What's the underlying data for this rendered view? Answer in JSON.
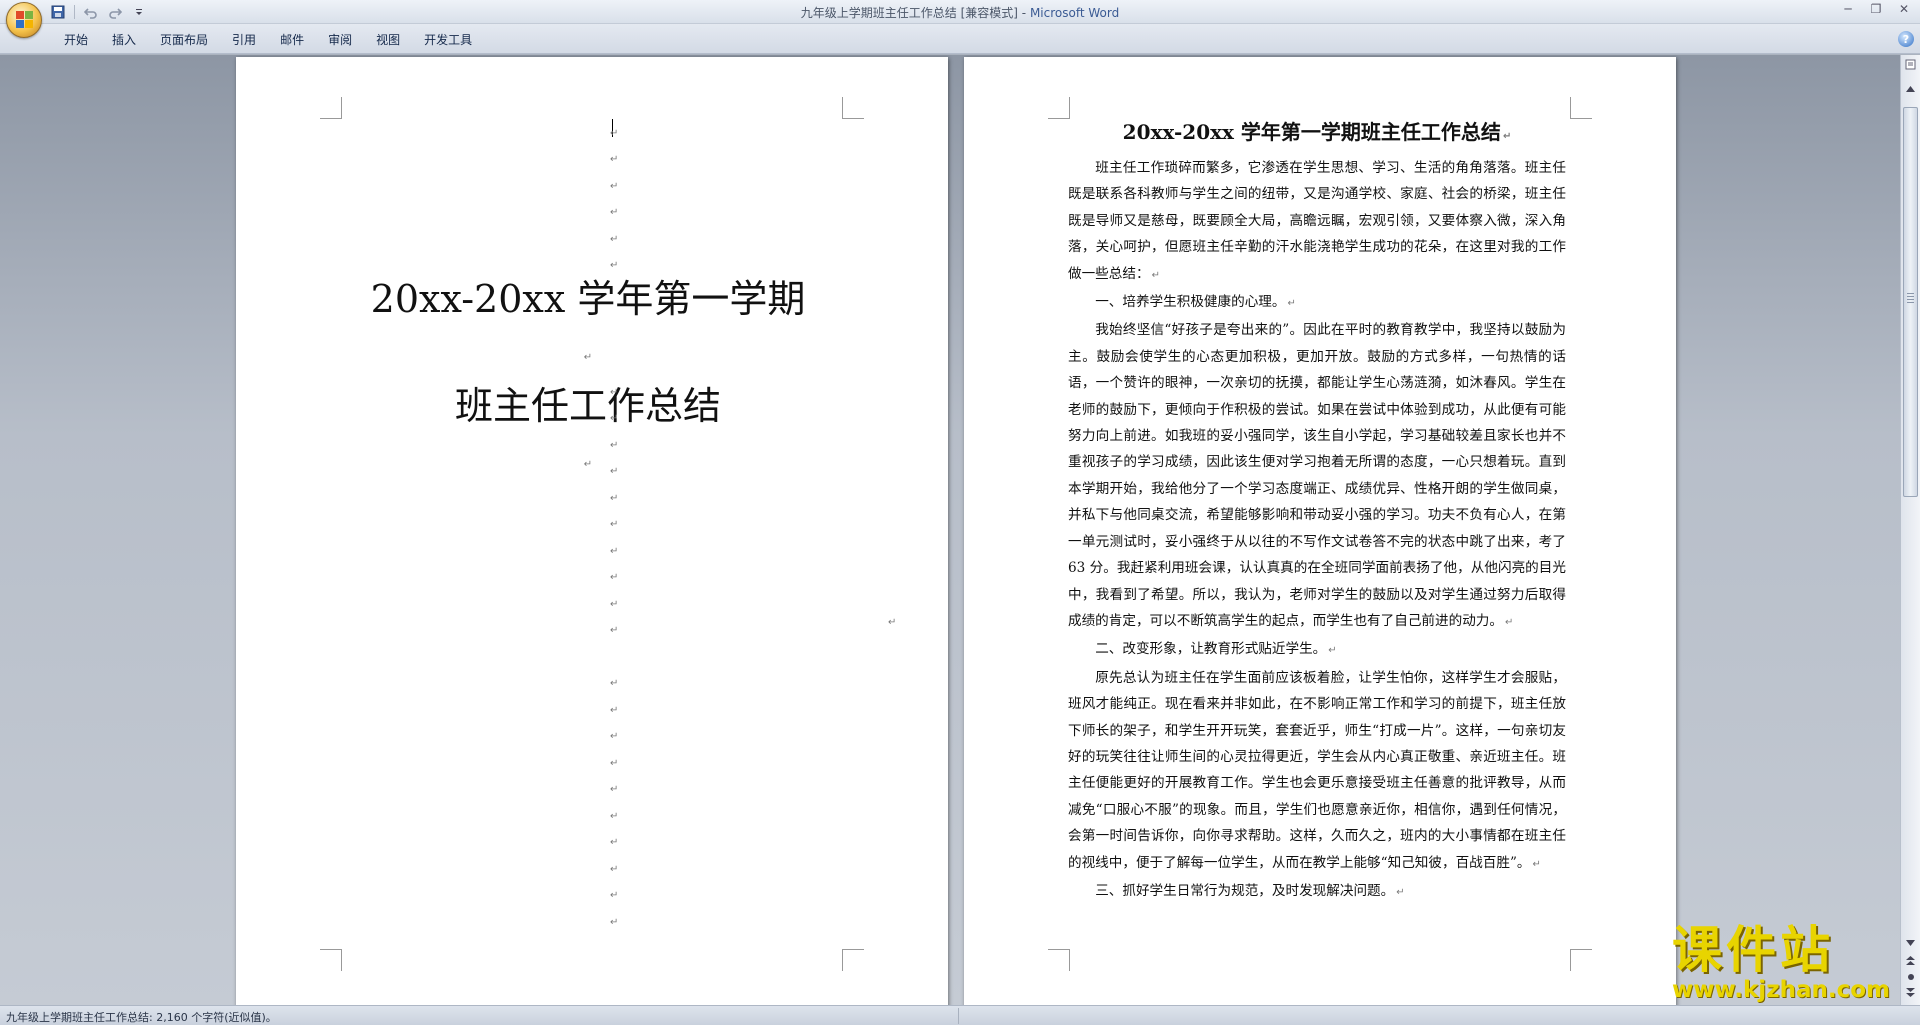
{
  "window": {
    "doc_name": "九年级上学期班主任工作总结 [兼容模式]",
    "separator": " - ",
    "app_name": "Microsoft Word"
  },
  "quick_access": {
    "save_icon": "save-icon",
    "undo_icon": "undo-icon",
    "redo_icon": "redo-icon",
    "customize_icon": "dropdown-icon"
  },
  "window_controls": {
    "minimize": "─",
    "restore": "❐",
    "close": "✕"
  },
  "ribbon": {
    "tabs": [
      "开始",
      "插入",
      "页面布局",
      "引用",
      "邮件",
      "审阅",
      "视图",
      "开发工具"
    ],
    "help": "?"
  },
  "paragraph_mark": "↵",
  "page1": {
    "cover_title_line1": "20xx-20xx 学年第一学期",
    "cover_title_line2": "班主任工作总结"
  },
  "page2": {
    "title": "20xx-20xx 学年第一学期班主任工作总结",
    "paragraphs": [
      "班主任工作琐碎而繁多，它渗透在学生思想、学习、生活的角角落落。班主任既是联系各科教师与学生之间的纽带，又是沟通学校、家庭、社会的桥梁，班主任既是导师又是慈母，既要顾全大局，高瞻远瞩，宏观引领，又要体察入微，深入角落，关心呵护，但愿班主任辛勤的汗水能浇艳学生成功的花朵，在这里对我的工作做一些总结：",
      "一、培养学生积极健康的心理。",
      "我始终坚信“好孩子是夸出来的”。因此在平时的教育教学中，我坚持以鼓励为主。鼓励会使学生的心态更加积极，更加开放。鼓励的方式多样，一句热情的话语，一个赞许的眼神，一次亲切的抚摸，都能让学生心荡涟漪，如沐春风。学生在老师的鼓励下，更倾向于作积极的尝试。如果在尝试中体验到成功，从此便有可能努力向上前进。如我班的妥小强同学，该生自小学起，学习基础较差且家长也并不重视孩子的学习成绩，因此该生便对学习抱着无所谓的态度，一心只想着玩。直到本学期开始，我给他分了一个学习态度端正、成绩优异、性格开朗的学生做同桌，并私下与他同桌交流，希望能够影响和带动妥小强的学习。功夫不负有心人，在第一单元测试时，妥小强终于从以往的不写作文试卷答不完的状态中跳了出来，考了 63 分。我赶紧利用班会课，认认真真的在全班同学面前表扬了他，从他闪亮的目光中，我看到了希望。所以，我认为，老师对学生的鼓励以及对学生通过努力后取得成绩的肯定，可以不断筑高学生的起点，而学生也有了自己前进的动力。",
      "二、改变形象，让教育形式贴近学生。",
      "原先总认为班主任在学生面前应该板着脸，让学生怕你，这样学生才会服贴，班风才能纯正。现在看来并非如此，在不影响正常工作和学习的前提下，班主任放下师长的架子，和学生开开玩笑，套套近乎，师生“打成一片”。这样，一句亲切友好的玩笑往往让师生间的心灵拉得更近，学生会从内心真正敬重、亲近班主任。班主任便能更好的开展教育工作。学生也会更乐意接受班主任善意的批评教导，从而减免“口服心不服”的现象。而且，学生们也愿意亲近你，相信你，遇到任何情况，会第一时间告诉你，向你寻求帮助。这样，久而久之，班内的大小事情都在班主任的视线中，便于了解每一位学生，从而在教学上能够“知己知彼，百战百胜”。",
      "三、抓好学生日常行为规范，及时发现解决问题。"
    ]
  },
  "status_bar": {
    "text": "九年级上学期班主任工作总结: 2,160 个字符(近似值)。"
  },
  "watermark": {
    "chinese": "课件站",
    "url": "www.kjzhan.com"
  },
  "colors": {
    "accent": "#3b5b94",
    "watermark": "#e8d400"
  }
}
